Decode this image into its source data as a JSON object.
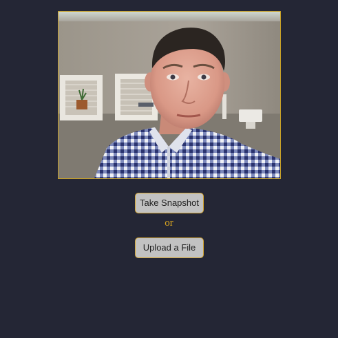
{
  "camera": {
    "alt": "Webcam preview",
    "border_color": "#c9a227"
  },
  "actions": {
    "snapshot_label": "Take Snapshot",
    "separator": "or",
    "upload_label": "Upload a File"
  },
  "colors": {
    "background": "#242635",
    "button_bg": "#c2c2c2",
    "button_border": "#d4a531",
    "accent_text": "#d9a521"
  }
}
